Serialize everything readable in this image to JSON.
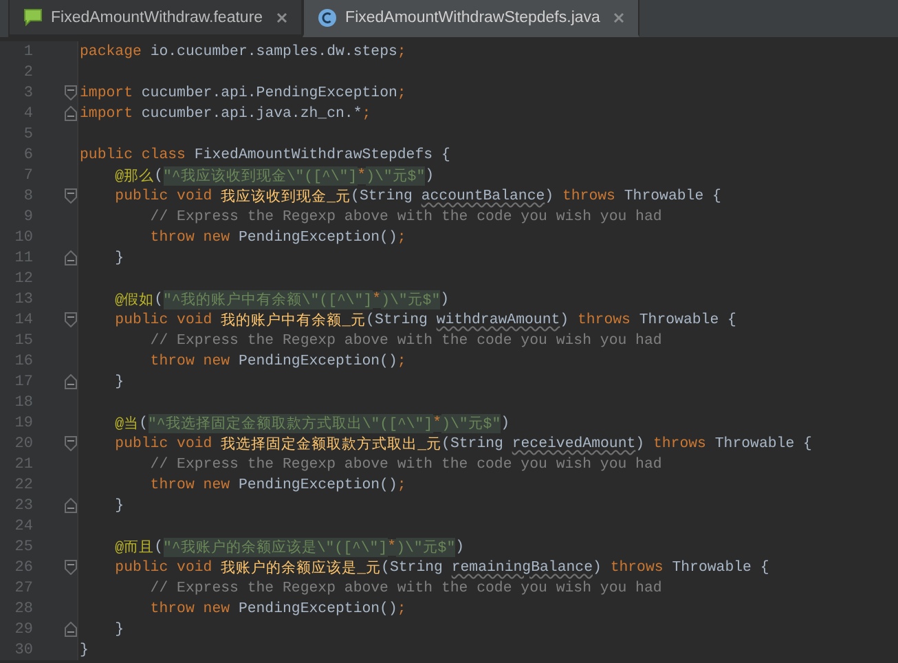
{
  "tabs": [
    {
      "label": "FixedAmountWithdraw.feature",
      "kind": "feature",
      "selected": false
    },
    {
      "label": "FixedAmountWithdrawStepdefs.java",
      "kind": "class",
      "selected": true
    }
  ],
  "lines": [
    {
      "number": "1",
      "tokens": [
        {
          "kind": "kw",
          "text": "package"
        },
        {
          "kind": "plain",
          "text": " io.cucumber.samples.dw.steps"
        },
        {
          "kind": "punct",
          "text": ";"
        }
      ]
    },
    {
      "number": "2"
    },
    {
      "number": "3",
      "fold": {
        "kind": "start"
      },
      "tokens": [
        {
          "kind": "kw",
          "text": "import"
        },
        {
          "kind": "plain",
          "text": " cucumber.api.PendingException"
        },
        {
          "kind": "punct",
          "text": ";"
        }
      ]
    },
    {
      "number": "4",
      "fold": {
        "kind": "end"
      },
      "tokens": [
        {
          "kind": "kw",
          "text": "import"
        },
        {
          "kind": "plain",
          "text": " cucumber.api.java.zh_cn.*"
        },
        {
          "kind": "punct",
          "text": ";"
        }
      ]
    },
    {
      "number": "5"
    },
    {
      "number": "6",
      "tokens": [
        {
          "kind": "kw",
          "text": "public class"
        },
        {
          "kind": "plain",
          "text": " FixedAmountWithdrawStepdefs {"
        }
      ]
    },
    {
      "number": "7",
      "tokens": [
        {
          "kind": "annotation",
          "text": "    @那么"
        },
        {
          "kind": "plain",
          "text": "("
        },
        {
          "kind": "string",
          "text": "\"^我应该收到现金\\\"([^\\\"]"
        },
        {
          "kind": "regex",
          "text": "*"
        },
        {
          "kind": "string",
          "text": ")\\\"元$\""
        },
        {
          "kind": "plain",
          "text": ")"
        }
      ]
    },
    {
      "number": "8",
      "fold": {
        "kind": "start"
      },
      "tokens": [
        {
          "kind": "kw",
          "text": "    public void"
        },
        {
          "kind": "method",
          "text": " 我应该收到现金_元"
        },
        {
          "kind": "plain",
          "text": "(String "
        },
        {
          "kind": "param",
          "text": "accountBalance"
        },
        {
          "kind": "plain",
          "text": ") "
        },
        {
          "kind": "kw",
          "text": "throws"
        },
        {
          "kind": "plain",
          "text": " Throwable {"
        }
      ]
    },
    {
      "number": "9",
      "tokens": [
        {
          "kind": "comment",
          "text": "        // Express the Regexp above with the code you wish you had"
        }
      ]
    },
    {
      "number": "10",
      "tokens": [
        {
          "kind": "kw",
          "text": "        throw new"
        },
        {
          "kind": "plain",
          "text": " PendingException()"
        },
        {
          "kind": "punct",
          "text": ";"
        }
      ]
    },
    {
      "number": "11",
      "fold": {
        "kind": "end"
      },
      "tokens": [
        {
          "kind": "plain",
          "text": "    }"
        }
      ]
    },
    {
      "number": "12"
    },
    {
      "number": "13",
      "tokens": [
        {
          "kind": "annotation",
          "text": "    @假如"
        },
        {
          "kind": "plain",
          "text": "("
        },
        {
          "kind": "string",
          "text": "\"^我的账户中有余额\\\"([^\\\"]"
        },
        {
          "kind": "regex",
          "text": "*"
        },
        {
          "kind": "string",
          "text": ")\\\"元$\""
        },
        {
          "kind": "plain",
          "text": ")"
        }
      ]
    },
    {
      "number": "14",
      "fold": {
        "kind": "start"
      },
      "tokens": [
        {
          "kind": "kw",
          "text": "    public void"
        },
        {
          "kind": "method",
          "text": " 我的账户中有余额_元"
        },
        {
          "kind": "plain",
          "text": "(String "
        },
        {
          "kind": "param",
          "text": "withdrawAmount"
        },
        {
          "kind": "plain",
          "text": ") "
        },
        {
          "kind": "kw",
          "text": "throws"
        },
        {
          "kind": "plain",
          "text": " Throwable {"
        }
      ]
    },
    {
      "number": "15",
      "tokens": [
        {
          "kind": "comment",
          "text": "        // Express the Regexp above with the code you wish you had"
        }
      ]
    },
    {
      "number": "16",
      "tokens": [
        {
          "kind": "kw",
          "text": "        throw new"
        },
        {
          "kind": "plain",
          "text": " PendingException()"
        },
        {
          "kind": "punct",
          "text": ";"
        }
      ]
    },
    {
      "number": "17",
      "fold": {
        "kind": "end"
      },
      "tokens": [
        {
          "kind": "plain",
          "text": "    }"
        }
      ]
    },
    {
      "number": "18"
    },
    {
      "number": "19",
      "tokens": [
        {
          "kind": "annotation",
          "text": "    @当"
        },
        {
          "kind": "plain",
          "text": "("
        },
        {
          "kind": "string",
          "text": "\"^我选择固定金额取款方式取出\\\"([^\\\"]"
        },
        {
          "kind": "regex",
          "text": "*"
        },
        {
          "kind": "string",
          "text": ")\\\"元$\""
        },
        {
          "kind": "plain",
          "text": ")"
        }
      ]
    },
    {
      "number": "20",
      "fold": {
        "kind": "start"
      },
      "tokens": [
        {
          "kind": "kw",
          "text": "    public void"
        },
        {
          "kind": "method",
          "text": " 我选择固定金额取款方式取出_元"
        },
        {
          "kind": "plain",
          "text": "(String "
        },
        {
          "kind": "param",
          "text": "receivedAmount"
        },
        {
          "kind": "plain",
          "text": ") "
        },
        {
          "kind": "kw",
          "text": "throws"
        },
        {
          "kind": "plain",
          "text": " Throwable {"
        }
      ]
    },
    {
      "number": "21",
      "tokens": [
        {
          "kind": "comment",
          "text": "        // Express the Regexp above with the code you wish you had"
        }
      ]
    },
    {
      "number": "22",
      "tokens": [
        {
          "kind": "kw",
          "text": "        throw new"
        },
        {
          "kind": "plain",
          "text": " PendingException()"
        },
        {
          "kind": "punct",
          "text": ";"
        }
      ]
    },
    {
      "number": "23",
      "fold": {
        "kind": "end"
      },
      "tokens": [
        {
          "kind": "plain",
          "text": "    }"
        }
      ]
    },
    {
      "number": "24"
    },
    {
      "number": "25",
      "tokens": [
        {
          "kind": "annotation",
          "text": "    @而且"
        },
        {
          "kind": "plain",
          "text": "("
        },
        {
          "kind": "string",
          "text": "\"^我账户的余额应该是\\\"([^\\\"]"
        },
        {
          "kind": "regex",
          "text": "*"
        },
        {
          "kind": "string",
          "text": ")\\\"元$\""
        },
        {
          "kind": "plain",
          "text": ")"
        }
      ]
    },
    {
      "number": "26",
      "fold": {
        "kind": "start"
      },
      "tokens": [
        {
          "kind": "kw",
          "text": "    public void"
        },
        {
          "kind": "method",
          "text": " 我账户的余额应该是_元"
        },
        {
          "kind": "plain",
          "text": "(String "
        },
        {
          "kind": "param",
          "text": "remainingBalance"
        },
        {
          "kind": "plain",
          "text": ") "
        },
        {
          "kind": "kw",
          "text": "throws"
        },
        {
          "kind": "plain",
          "text": " Throwable {"
        }
      ]
    },
    {
      "number": "27",
      "tokens": [
        {
          "kind": "comment",
          "text": "        // Express the Regexp above with the code you wish you had"
        }
      ]
    },
    {
      "number": "28",
      "tokens": [
        {
          "kind": "kw",
          "text": "        throw new"
        },
        {
          "kind": "plain",
          "text": " PendingException()"
        },
        {
          "kind": "punct",
          "text": ";"
        }
      ]
    },
    {
      "number": "29",
      "fold": {
        "kind": "end"
      },
      "tokens": [
        {
          "kind": "plain",
          "text": "    }"
        }
      ]
    },
    {
      "number": "30",
      "tokens": [
        {
          "kind": "plain",
          "text": "}"
        }
      ]
    }
  ]
}
